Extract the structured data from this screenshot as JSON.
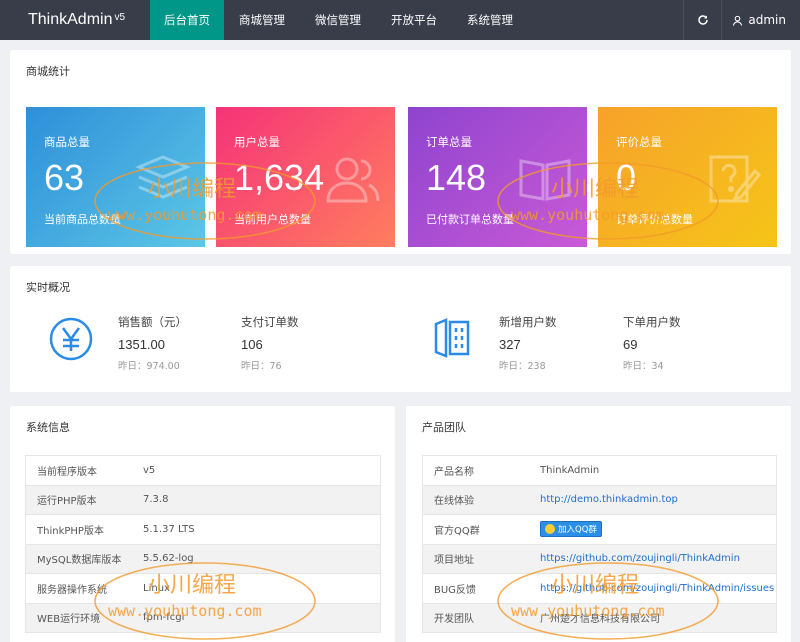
{
  "app": {
    "name": "ThinkAdmin",
    "version": "v5"
  },
  "nav": [
    {
      "label": "后台首页",
      "active": true
    },
    {
      "label": "商城管理",
      "active": false
    },
    {
      "label": "微信管理",
      "active": false
    },
    {
      "label": "开放平台",
      "active": false
    },
    {
      "label": "系统管理",
      "active": false
    }
  ],
  "user": {
    "name": "admin"
  },
  "mall": {
    "title": "商城统计",
    "cards": [
      {
        "label": "商品总量",
        "value": "63",
        "sub": "当前商品总数量",
        "icon": "stack-icon",
        "gradient": [
          "#2e8fd8",
          "#5cc7e6"
        ]
      },
      {
        "label": "用户总量",
        "value": "1,634",
        "sub": "当前用户总数量",
        "icon": "users-icon",
        "gradient": [
          "#f53379",
          "#ff7e5f"
        ]
      },
      {
        "label": "订单总量",
        "value": "148",
        "sub": "已付款订单总数量",
        "icon": "book-icon",
        "gradient": [
          "#8e44cf",
          "#c95ad6"
        ]
      },
      {
        "label": "评价总量",
        "value": "0",
        "sub": "订单评价总数量",
        "icon": "edit-question-icon",
        "gradient": [
          "#f7a22b",
          "#f5c518"
        ]
      }
    ]
  },
  "realtime": {
    "title": "实时概况",
    "left": [
      {
        "title": "销售额（元）",
        "value": "1351.00",
        "yesterday": "昨日：974.00"
      },
      {
        "title": "支付订单数",
        "value": "106",
        "yesterday": "昨日：76"
      }
    ],
    "right": [
      {
        "title": "新增用户数",
        "value": "327",
        "yesterday": "昨日：238"
      },
      {
        "title": "下单用户数",
        "value": "69",
        "yesterday": "昨日：34"
      }
    ]
  },
  "system": {
    "title": "系统信息",
    "rows": [
      {
        "k": "当前程序版本",
        "v": "v5"
      },
      {
        "k": "运行PHP版本",
        "v": "7.3.8"
      },
      {
        "k": "ThinkPHP版本",
        "v": "5.1.37 LTS"
      },
      {
        "k": "MySQL数据库版本",
        "v": "5.5.62-log"
      },
      {
        "k": "服务器操作系统",
        "v": "Linux"
      },
      {
        "k": "WEB运行环境",
        "v": "fpm-fcgi"
      }
    ]
  },
  "team": {
    "title": "产品团队",
    "rows": [
      {
        "k": "产品名称",
        "v": "ThinkAdmin",
        "link": false
      },
      {
        "k": "在线体验",
        "v": "http://demo.thinkadmin.top",
        "link": true
      },
      {
        "k": "官方QQ群",
        "v": "加入QQ群",
        "qq": true
      },
      {
        "k": "项目地址",
        "v": "https://github.com/zoujingli/ThinkAdmin",
        "link": true
      },
      {
        "k": "BUG反馈",
        "v": "https://github.com/zoujingli/ThinkAdmin/issues",
        "link": true
      },
      {
        "k": "开发团队",
        "v": "广州楚才信息科技有限公司",
        "link": false
      }
    ]
  },
  "watermark": {
    "cn": "小川编程",
    "url": "www.youhutong.com",
    "color": "#f39a2c"
  }
}
